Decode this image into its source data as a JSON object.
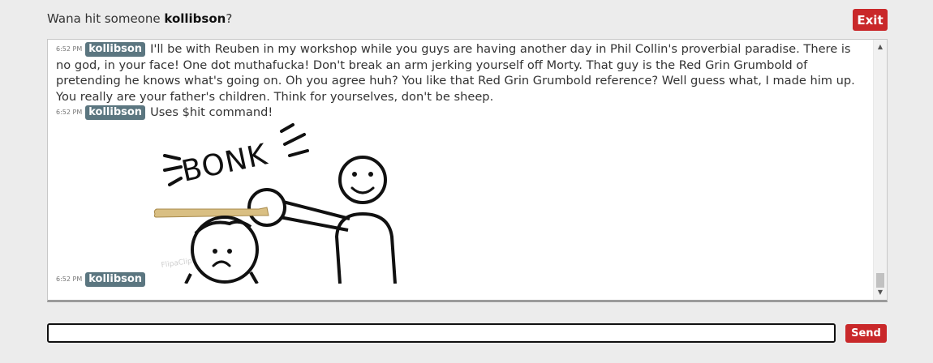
{
  "header": {
    "prompt_prefix": "Wana hit someone ",
    "prompt_user": "kollibson",
    "prompt_suffix": "?",
    "exit_label": "Exit"
  },
  "chat": {
    "messages": [
      {
        "time": "6:52 PM",
        "user": "kollibson",
        "text": "I'll be with Reuben in my workshop while you guys are having another day in Phil Collin's proverbial paradise. There is no god, in your face! One dot muthafucka! Don't break an arm jerking yourself off Morty. That guy is the Red Grin Grumbold of pretending he knows what's going on. Oh you agree huh? You like that Red Grin Grumbold reference? Well guess what, I made him up. You really are your father's children. Think for yourselves, don't be sheep."
      },
      {
        "time": "6:52 PM",
        "user": "kollibson",
        "text": "Uses $hit command!"
      },
      {
        "time": "6:52 PM",
        "user": "kollibson",
        "text": "",
        "image": {
          "icon": "bonk-image",
          "caption": "BONK",
          "watermark": "FlipaClip"
        }
      }
    ]
  },
  "composer": {
    "input_value": "",
    "send_label": "Send"
  },
  "colors": {
    "accent_red": "#c9282a",
    "badge": "#5b7680",
    "background": "#ececec"
  }
}
